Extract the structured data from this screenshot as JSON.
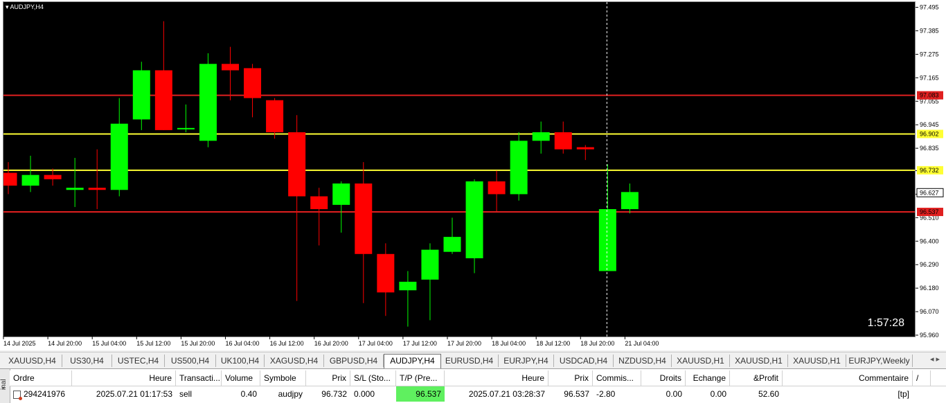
{
  "chart": {
    "title": "AUDJPY,H4",
    "timer": "1:57:28",
    "colors": {
      "background": "#000000",
      "bull": "#00ff00",
      "bear": "#ff0000",
      "resistance": "#e02020",
      "support": "#ffff33",
      "crosshair": "#ffffff"
    }
  },
  "chart_data": {
    "type": "candlestick",
    "symbol": "AUDJPY",
    "timeframe": "H4",
    "ylim": [
      95.96,
      97.5
    ],
    "y_ticks": [
      "97.495",
      "97.385",
      "97.275",
      "97.165",
      "97.055",
      "96.945",
      "96.835",
      "96.730",
      "96.620",
      "96.510",
      "96.400",
      "96.290",
      "96.180",
      "96.070",
      "95.960"
    ],
    "x_labels": [
      "14 Jul 2025",
      "14 Jul 20:00",
      "15 Jul 04:00",
      "15 Jul 12:00",
      "15 Jul 20:00",
      "16 Jul 04:00",
      "16 Jul 12:00",
      "16 Jul 20:00",
      "17 Jul 04:00",
      "17 Jul 12:00",
      "17 Jul 20:00",
      "18 Jul 04:00",
      "18 Jul 12:00",
      "18 Jul 20:00",
      "21 Jul 04:00"
    ],
    "candles": [
      {
        "o": 96.72,
        "h": 96.77,
        "l": 96.62,
        "c": 96.66
      },
      {
        "o": 96.66,
        "h": 96.8,
        "l": 96.63,
        "c": 96.71
      },
      {
        "o": 96.71,
        "h": 96.74,
        "l": 96.66,
        "c": 96.69
      },
      {
        "o": 96.64,
        "h": 96.79,
        "l": 96.56,
        "c": 96.65
      },
      {
        "o": 96.65,
        "h": 96.83,
        "l": 96.55,
        "c": 96.64
      },
      {
        "o": 96.64,
        "h": 97.07,
        "l": 96.61,
        "c": 96.95
      },
      {
        "o": 96.97,
        "h": 97.24,
        "l": 96.92,
        "c": 97.2
      },
      {
        "o": 97.2,
        "h": 97.43,
        "l": 96.92,
        "c": 96.92
      },
      {
        "o": 96.93,
        "h": 97.04,
        "l": 96.91,
        "c": 96.93
      },
      {
        "o": 96.87,
        "h": 97.28,
        "l": 96.84,
        "c": 97.23
      },
      {
        "o": 97.23,
        "h": 97.31,
        "l": 97.06,
        "c": 97.2
      },
      {
        "o": 97.21,
        "h": 97.23,
        "l": 96.98,
        "c": 97.07
      },
      {
        "o": 97.06,
        "h": 97.07,
        "l": 96.88,
        "c": 96.91
      },
      {
        "o": 96.91,
        "h": 96.99,
        "l": 96.12,
        "c": 96.61
      },
      {
        "o": 96.61,
        "h": 96.65,
        "l": 96.38,
        "c": 96.55
      },
      {
        "o": 96.57,
        "h": 96.68,
        "l": 96.44,
        "c": 96.67
      },
      {
        "o": 96.67,
        "h": 96.77,
        "l": 96.11,
        "c": 96.34
      },
      {
        "o": 96.34,
        "h": 96.39,
        "l": 96.05,
        "c": 96.16
      },
      {
        "o": 96.17,
        "h": 96.26,
        "l": 96.0,
        "c": 96.21
      },
      {
        "o": 96.22,
        "h": 96.39,
        "l": 96.03,
        "c": 96.36
      },
      {
        "o": 96.35,
        "h": 96.51,
        "l": 96.34,
        "c": 96.42
      },
      {
        "o": 96.32,
        "h": 96.69,
        "l": 96.25,
        "c": 96.68
      },
      {
        "o": 96.68,
        "h": 96.73,
        "l": 96.54,
        "c": 96.62
      },
      {
        "o": 96.62,
        "h": 96.91,
        "l": 96.59,
        "c": 96.87
      },
      {
        "o": 96.87,
        "h": 96.96,
        "l": 96.81,
        "c": 96.91
      },
      {
        "o": 96.91,
        "h": 96.96,
        "l": 96.81,
        "c": 96.83
      },
      {
        "o": 96.84,
        "h": 96.85,
        "l": 96.78,
        "c": 96.83
      },
      {
        "o": 96.26,
        "h": 96.76,
        "l": 96.26,
        "c": 96.55
      },
      {
        "o": 96.55,
        "h": 96.67,
        "l": 96.53,
        "c": 96.63
      }
    ],
    "hlines": [
      {
        "price": 97.083,
        "label": "97.083",
        "kind": "resistance"
      },
      {
        "price": 96.902,
        "label": "96.902",
        "kind": "support"
      },
      {
        "price": 96.732,
        "label": "96.732",
        "kind": "support"
      },
      {
        "price": 96.537,
        "label": "96.537",
        "kind": "resistance"
      }
    ],
    "current_price": {
      "price": 96.627,
      "label": "96.627"
    },
    "crosshair_candle_index": 27
  },
  "tabs": [
    {
      "label": "XAUUSD,H4",
      "active": false
    },
    {
      "label": "US30,H4",
      "active": false
    },
    {
      "label": "USTEC,H4",
      "active": false
    },
    {
      "label": "US500,H4",
      "active": false
    },
    {
      "label": "UK100,H4",
      "active": false
    },
    {
      "label": "XAGUSD,H4",
      "active": false
    },
    {
      "label": "GBPUSD,H4",
      "active": false
    },
    {
      "label": "AUDJPY,H4",
      "active": true
    },
    {
      "label": "EURUSD,H4",
      "active": false
    },
    {
      "label": "EURJPY,H4",
      "active": false
    },
    {
      "label": "USDCAD,H4",
      "active": false
    },
    {
      "label": "NZDUSD,H4",
      "active": false
    },
    {
      "label": "XAUUSD,H1",
      "active": false
    },
    {
      "label": "XAUUSD,H1",
      "active": false
    },
    {
      "label": "XAUUSD,H1",
      "active": false
    },
    {
      "label": "EURJPY,Weekly",
      "active": false
    }
  ],
  "tab_scroll_label": "◂ ▸",
  "terminal": {
    "side_label": "inal",
    "close_label": "×",
    "headers": [
      "Ordre",
      "Heure",
      "Transacti...",
      "Volume",
      "Symbole",
      "Prix",
      "S/L (Sto...",
      "T/P (Pre...",
      "Heure",
      "Prix",
      "Commis...",
      "Droits",
      "Echange",
      "&Profit",
      "Commentaire",
      "/"
    ],
    "row": [
      "294241976",
      "2025.07.21 01:17:53",
      "sell",
      "0.40",
      "audjpy",
      "96.732",
      "0.000",
      "96.537",
      "2025.07.21 03:28:37",
      "96.537",
      "-2.80",
      "0.00",
      "0.00",
      "52.60",
      "[tp]"
    ]
  }
}
